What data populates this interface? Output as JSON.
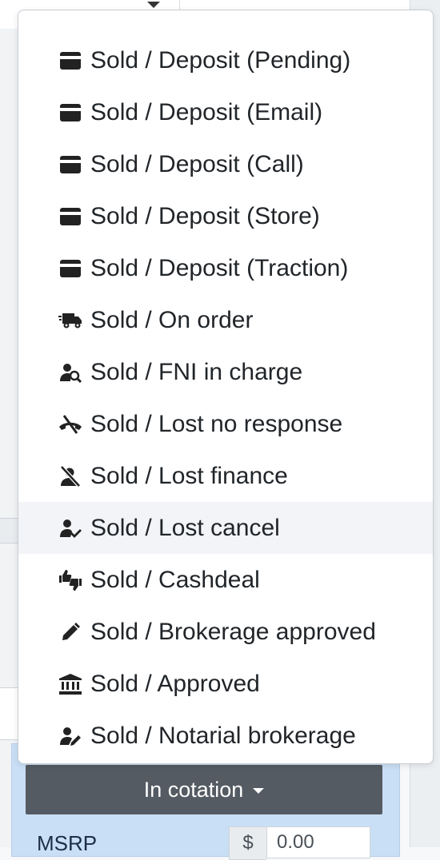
{
  "status_menu": {
    "items": [
      {
        "label": "Sold / Deposit (Pending)",
        "icon": "credit-card-icon"
      },
      {
        "label": "Sold / Deposit (Email)",
        "icon": "credit-card-icon"
      },
      {
        "label": "Sold / Deposit (Call)",
        "icon": "credit-card-icon"
      },
      {
        "label": "Sold / Deposit (Store)",
        "icon": "credit-card-icon"
      },
      {
        "label": "Sold / Deposit (Traction)",
        "icon": "credit-card-icon"
      },
      {
        "label": "Sold / On order",
        "icon": "shipping-fast-icon"
      },
      {
        "label": "Sold / FNI in charge",
        "icon": "user-search-icon"
      },
      {
        "label": "Sold / Lost no response",
        "icon": "phone-slash-icon"
      },
      {
        "label": "Sold / Lost finance",
        "icon": "user-slash-icon"
      },
      {
        "label": "Sold / Lost cancel",
        "icon": "user-check-icon",
        "highlighted": true
      },
      {
        "label": "Sold / Cashdeal",
        "icon": "thumbs-up-down-icon"
      },
      {
        "label": "Sold / Brokerage approved",
        "icon": "pen-icon"
      },
      {
        "label": "Sold / Approved",
        "icon": "bank-icon"
      },
      {
        "label": "Sold / Notarial brokerage",
        "icon": "user-edit-icon"
      }
    ]
  },
  "status_button": {
    "label": "In cotation"
  },
  "pricing": {
    "msrp_label": "MSRP",
    "currency_symbol": "$",
    "msrp_value": "0.00"
  },
  "colors": {
    "button_bg": "#555b63",
    "panel_bg": "#c9dff5",
    "highlight_bg": "#f3f4f7"
  }
}
